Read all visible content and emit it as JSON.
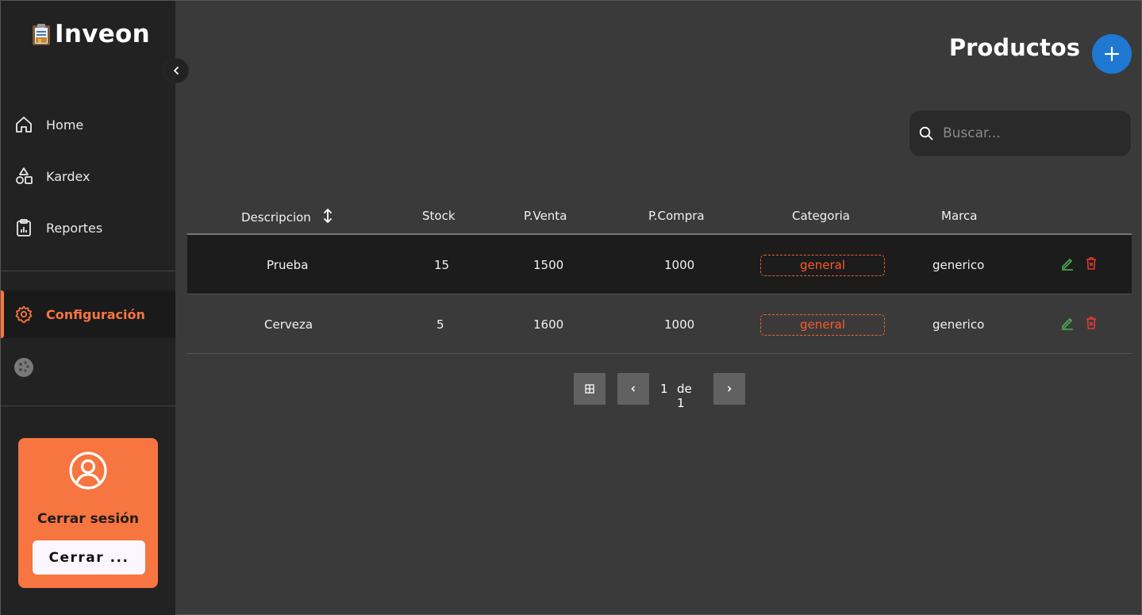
{
  "app": {
    "name": "Inveon"
  },
  "sidebar": {
    "items": [
      {
        "label": "Home",
        "icon": "home-icon"
      },
      {
        "label": "Kardex",
        "icon": "shapes-icon"
      },
      {
        "label": "Reportes",
        "icon": "clipboard-icon"
      }
    ],
    "settings": {
      "label": "Configuración",
      "icon": "gear-icon",
      "active": true
    },
    "theme_icon": "palette-icon",
    "logout": {
      "title": "Cerrar sesión",
      "button": "Cerrar ..."
    }
  },
  "header": {
    "title": "Productos",
    "add_icon": "plus-icon"
  },
  "search": {
    "placeholder": "Buscar..."
  },
  "table": {
    "columns": [
      "Descripcion",
      "Stock",
      "P.Venta",
      "P.Compra",
      "Categoria",
      "Marca"
    ],
    "rows": [
      {
        "descripcion": "Prueba",
        "stock": "15",
        "pventa": "1500",
        "pcompra": "1000",
        "categoria": "general",
        "marca": "generico"
      },
      {
        "descripcion": "Cerveza",
        "stock": "5",
        "pventa": "1600",
        "pcompra": "1000",
        "categoria": "general",
        "marca": "generico"
      }
    ]
  },
  "pagination": {
    "current": "1",
    "total_text": "de 1"
  },
  "colors": {
    "accent": "#f77540",
    "primary": "#1f78d1",
    "badge": "#ff5a2a",
    "edit": "#4caf50",
    "delete": "#e53935"
  }
}
